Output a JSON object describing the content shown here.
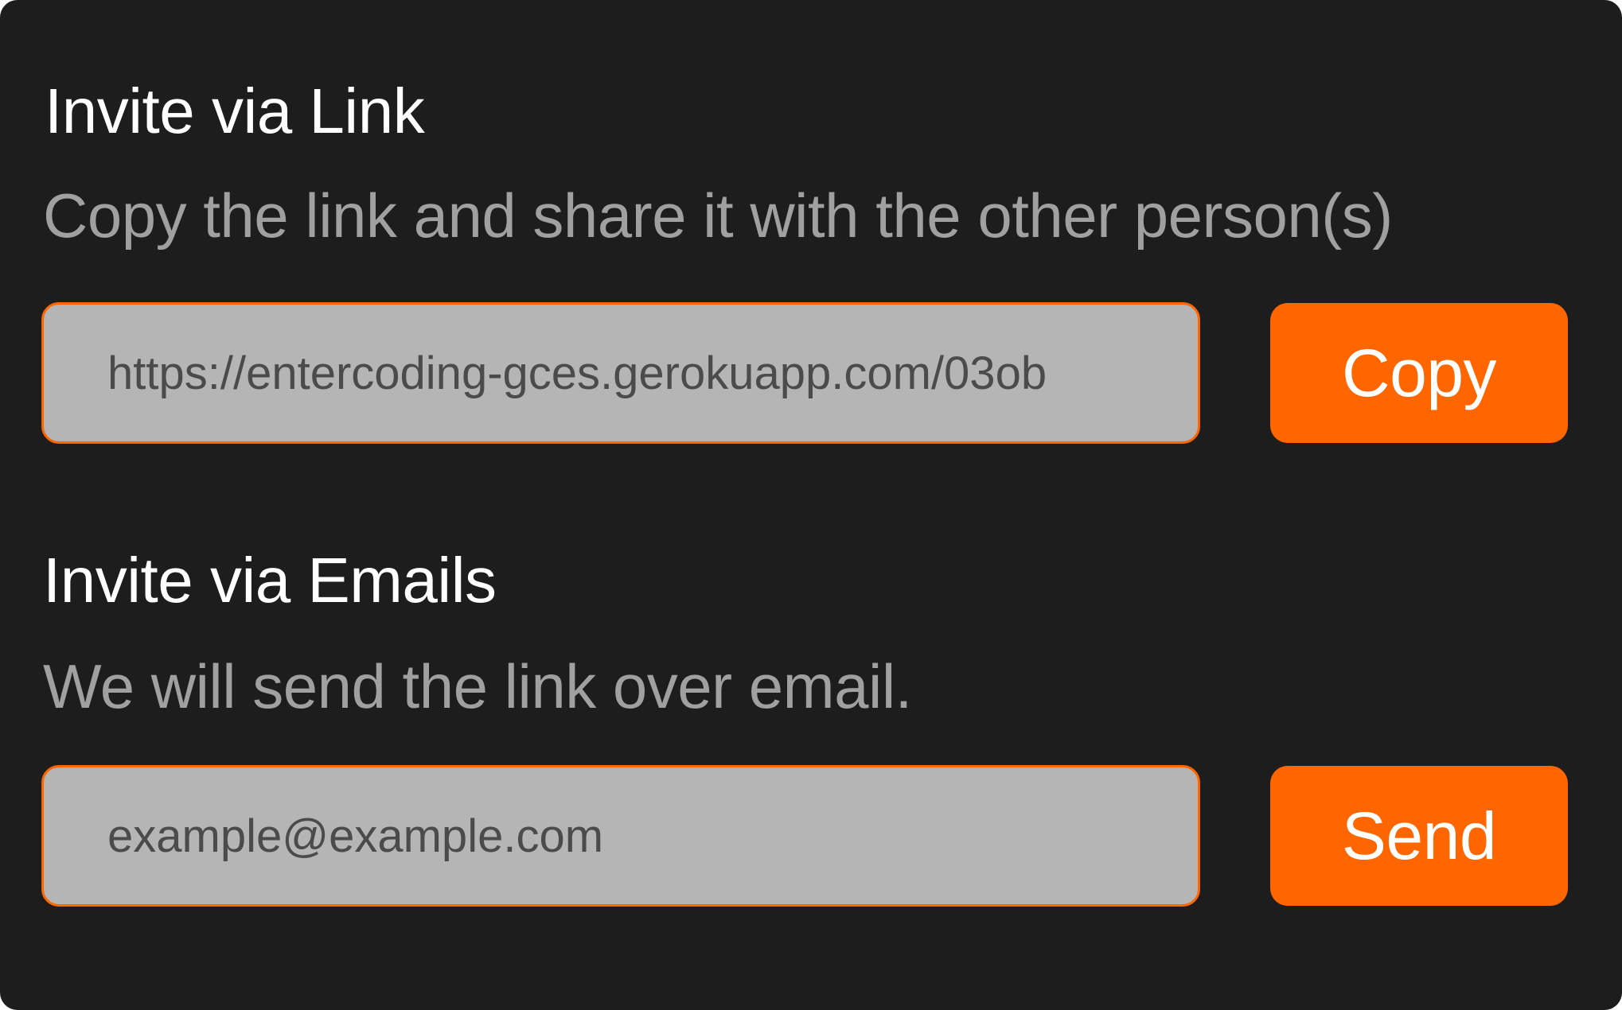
{
  "link_section": {
    "title": "Invite via Link",
    "description": "Copy the link and share it with the other person(s)",
    "link_value": "https://entercoding-gces.gerokuapp.com/03ob",
    "copy_label": "Copy"
  },
  "email_section": {
    "title": "Invite via Emails",
    "description": "We will send the link over email.",
    "email_placeholder": "example@example.com",
    "send_label": "Send"
  },
  "colors": {
    "background": "#1d1d1d",
    "accent": "#ff6600",
    "field_bg": "#b5b5b5",
    "heading": "#ffffff",
    "subtext": "#a0a0a0"
  }
}
